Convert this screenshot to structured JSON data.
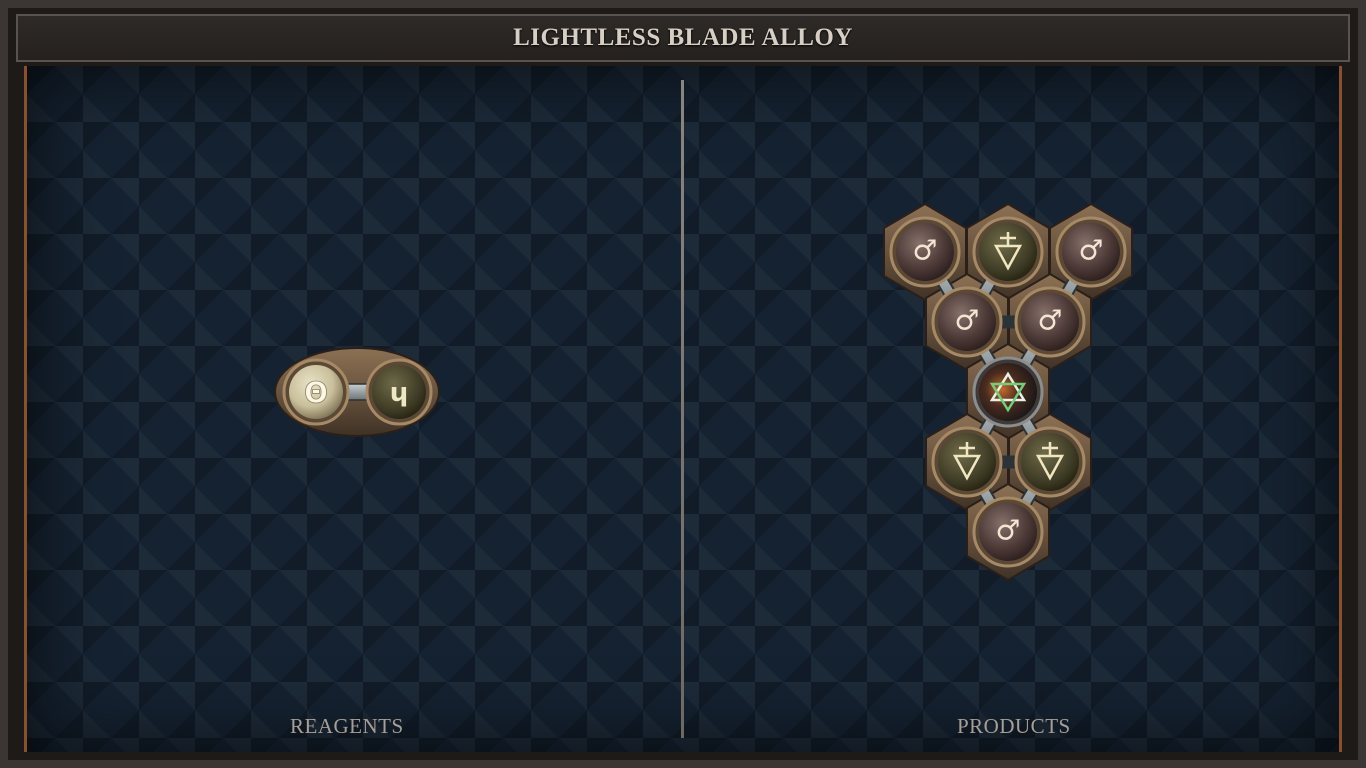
{
  "title": "LIGHTLESS BLADE ALLOY",
  "panels": {
    "reagents_label": "REAGENTS",
    "products_label": "PRODUCTS"
  },
  "reagents": [
    {
      "symbol": "Θ",
      "type": "reagent-a-icon"
    },
    {
      "symbol": "ɥ",
      "type": "reagent-b-icon"
    }
  ],
  "products": [
    {
      "symbol": "♂",
      "type": "iron-icon"
    },
    {
      "symbol": "🜄",
      "type": "earth-icon"
    },
    {
      "symbol": "✡",
      "type": "star-icon"
    }
  ],
  "colors": {
    "board": "#152231",
    "frame": "#3b3633",
    "accent_copper": "#8a4f2c",
    "bond": "#9aa3a6"
  }
}
